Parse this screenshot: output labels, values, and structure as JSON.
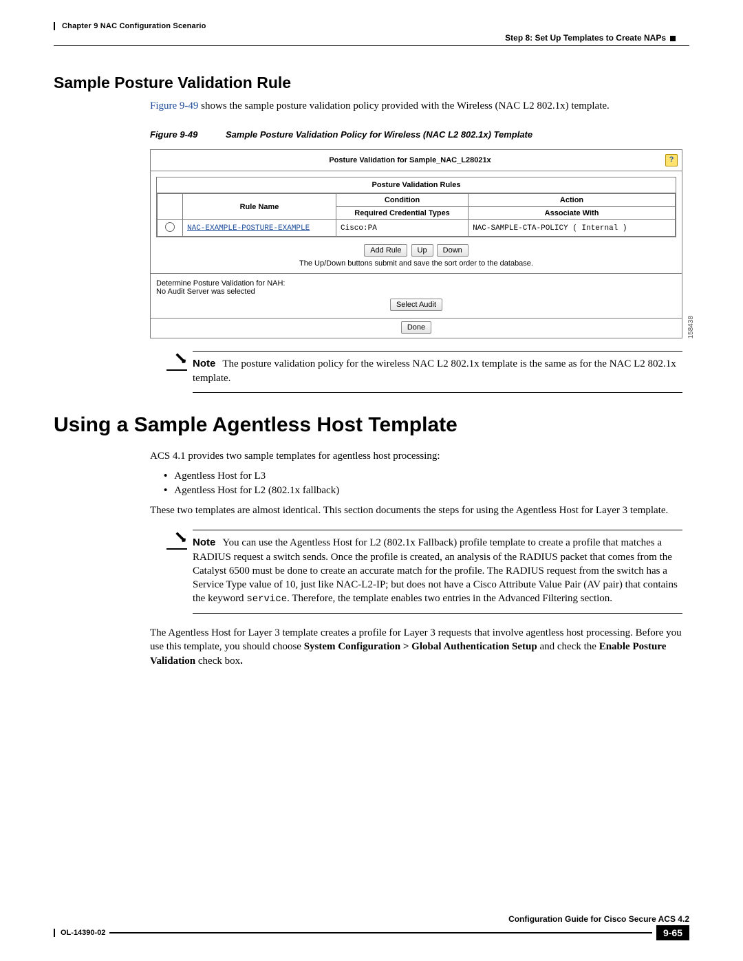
{
  "header": {
    "chapter": "Chapter 9    NAC Configuration Scenario",
    "step": "Step 8: Set Up Templates to Create NAPs"
  },
  "section1": {
    "heading": "Sample Posture Validation Rule",
    "intro_pre": "Figure 9-49",
    "intro_post": " shows the sample posture validation policy provided with the Wireless (NAC L2 802.1x) template.",
    "fig_label": "Figure 9-49",
    "fig_caption": "Sample Posture Validation Policy for Wireless (NAC L2 802.1x) Template"
  },
  "figure": {
    "title": "Posture Validation for Sample_NAC_L28021x",
    "rules_title": "Posture Validation Rules",
    "headers": {
      "rule": "Rule Name",
      "cond": "Condition",
      "cond_sub": "Required Credential Types",
      "action": "Action",
      "action_sub": "Associate With"
    },
    "row": {
      "name": "NAC-EXAMPLE-POSTURE-EXAMPLE",
      "cred": "Cisco:PA",
      "assoc": "NAC-SAMPLE-CTA-POLICY ( Internal )"
    },
    "buttons": {
      "add": "Add Rule",
      "up": "Up",
      "down": "Down",
      "select_audit": "Select Audit",
      "done": "Done"
    },
    "hint": "The Up/Down buttons submit and save the sort order to the database.",
    "nah_line1": "Determine Posture Validation for NAH:",
    "nah_line2": "No Audit Server was selected",
    "side_id": "158438"
  },
  "note1": {
    "label": "Note",
    "text": "The posture validation policy for the wireless NAC L2 802.1x template is the same as for the NAC L2 802.1x template."
  },
  "section2": {
    "heading": "Using a Sample Agentless Host Template",
    "p1": "ACS 4.1 provides two sample templates for agentless host processing:",
    "b1": "Agentless Host for L3",
    "b2": "Agentless Host for L2 (802.1x fallback)",
    "p2": "These two templates are almost identical. This section documents the steps for using the Agentless Host for Layer 3 template."
  },
  "note2": {
    "label": "Note",
    "text_pre": "You can use the Agentless Host for L2 (802.1x Fallback) profile template to create a profile that matches a RADIUS request a switch sends. Once the profile is created, an analysis of the RADIUS packet that comes from the Catalyst 6500 must be done to create an accurate match for the profile. The RADIUS request from the switch has a Service Type value of 10, just like NAC-L2-IP; but does not have a Cisco Attribute Value Pair (AV pair) that contains the keyword ",
    "code": "service",
    "text_post": ". Therefore, the template enables two entries in the Advanced Filtering section."
  },
  "p_final_pre": "The Agentless Host for Layer 3 template creates a profile for Layer 3 requests that involve agentless host processing. Before you use this template, you should choose ",
  "p_final_b1": "System Configuration > Global Authentication Setup",
  "p_final_mid": " and check the ",
  "p_final_b2": "Enable Posture Validation",
  "p_final_post": " check box",
  "p_final_dot": ".",
  "footer": {
    "guide": "Configuration Guide for Cisco Secure ACS 4.2",
    "ol": "OL-14390-02",
    "page": "9-65"
  }
}
